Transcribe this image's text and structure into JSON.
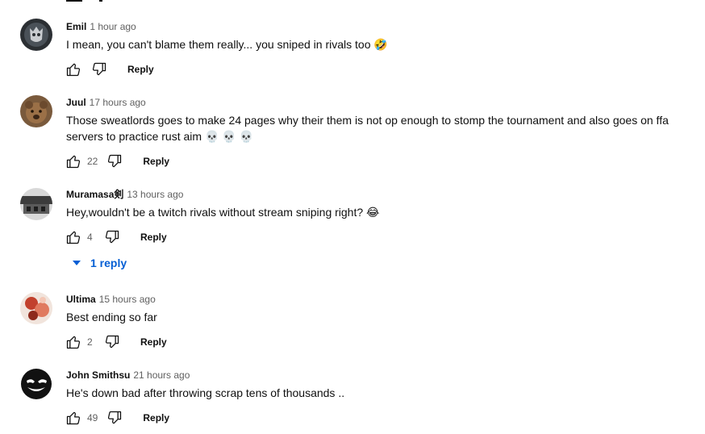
{
  "comments": [
    {
      "author": "Emil",
      "time": "1 hour ago",
      "text_lines": [
        "I mean, you can't blame them really... you sniped in rivals too 🤣"
      ],
      "likes": "",
      "reply_label": "Reply",
      "avatar_icon": "avatar-emil-icon"
    },
    {
      "author": "Juul",
      "time": "17 hours ago",
      "text_lines": [
        "Those sweatlords goes to make 24 pages why their them is not op enough to stomp the tournament and also goes on ffa",
        "servers to practice rust aim 💀 💀 💀"
      ],
      "likes": "22",
      "reply_label": "Reply",
      "avatar_icon": "avatar-juul-icon"
    },
    {
      "author": "Muramasa剣",
      "time": "13 hours ago",
      "text_lines": [
        "Hey,wouldn't be a twitch rivals without stream sniping right? 😂"
      ],
      "likes": "4",
      "reply_label": "Reply",
      "avatar_icon": "avatar-muramasa-icon",
      "replies_label": "1 reply"
    },
    {
      "author": "Ultima",
      "time": "15 hours ago",
      "text_lines": [
        "Best ending so far"
      ],
      "likes": "2",
      "reply_label": "Reply",
      "avatar_icon": "avatar-ultima-icon"
    },
    {
      "author": "John Smithsu",
      "time": "21 hours ago",
      "text_lines": [
        "He's down bad after throwing scrap tens of thousands .."
      ],
      "likes": "49",
      "reply_label": "Reply",
      "avatar_icon": "avatar-john-icon"
    }
  ],
  "colors": {
    "text": "#0f0f0f",
    "secondary": "#606060",
    "link": "#065fd4"
  }
}
